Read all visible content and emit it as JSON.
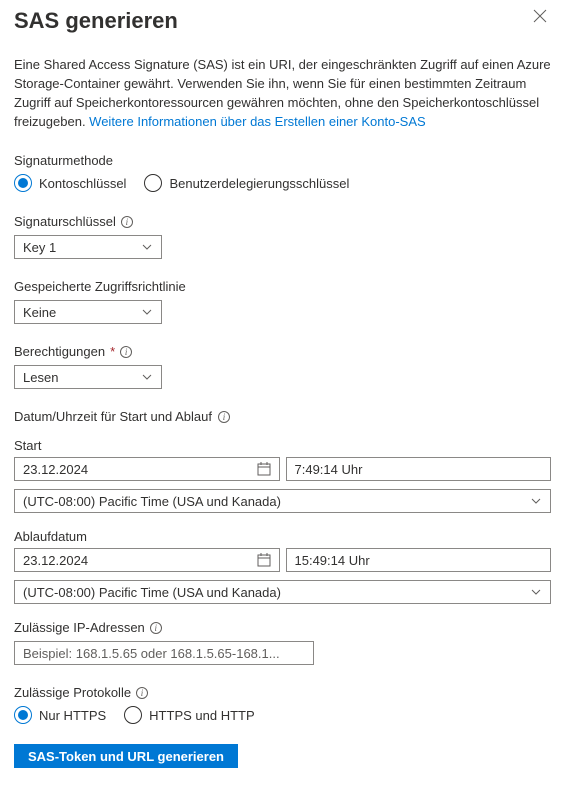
{
  "header": {
    "title": "SAS generieren"
  },
  "description": {
    "text": "Eine Shared Access Signature (SAS) ist ein URI, der eingeschränkten Zugriff auf einen Azure Storage-Container gewährt. Verwenden Sie ihn, wenn Sie für einen bestimmten Zeitraum Zugriff auf Speicherkontoressourcen gewähren möchten, ohne den Speicherkontoschlüssel freizugeben. ",
    "link_text": "Weitere Informationen über das Erstellen einer Konto-SAS"
  },
  "signatureMethod": {
    "label": "Signaturmethode",
    "options": {
      "accountKey": "Kontoschlüssel",
      "userDelegation": "Benutzerdelegierungsschlüssel"
    }
  },
  "signingKey": {
    "label": "Signaturschlüssel",
    "value": "Key 1"
  },
  "storedPolicy": {
    "label": "Gespeicherte Zugriffsrichtlinie",
    "value": "Keine"
  },
  "permissions": {
    "label": "Berechtigungen",
    "value": "Lesen"
  },
  "dateTime": {
    "header": "Datum/Uhrzeit für Start und Ablauf",
    "start": {
      "label": "Start",
      "date": "23.12.2024",
      "time": "7:49:14 Uhr"
    },
    "expiry": {
      "label": "Ablaufdatum",
      "date": "23.12.2024",
      "time": "15:49:14 Uhr"
    },
    "timezone": "(UTC-08:00) Pacific Time (USA und Kanada)"
  },
  "ipAddresses": {
    "label": "Zulässige IP-Adressen",
    "placeholder": "Beispiel: 168.1.5.65 oder 168.1.5.65-168.1..."
  },
  "protocols": {
    "label": "Zulässige Protokolle",
    "options": {
      "httpsOnly": "Nur HTTPS",
      "httpsAndHttp": "HTTPS und HTTP"
    }
  },
  "generateButton": {
    "label": "SAS-Token und URL generieren"
  }
}
